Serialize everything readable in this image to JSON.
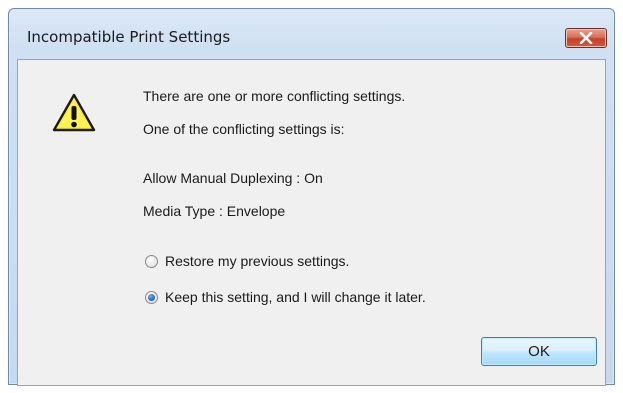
{
  "window": {
    "title": "Incompatible Print Settings"
  },
  "icons": {
    "warning": "warning-icon",
    "close": "close-icon"
  },
  "message": {
    "line1": "There are one or more conflicting settings.",
    "line2": "One of the conflicting settings is:",
    "setting1": "Allow Manual Duplexing : On",
    "setting2": "Media Type : Envelope"
  },
  "options": {
    "restore": {
      "label": "Restore my previous settings.",
      "checked": false
    },
    "keep": {
      "label": "Keep this setting, and I will change it later.",
      "checked": true
    }
  },
  "buttons": {
    "ok": "OK"
  },
  "colors": {
    "close_button": "#c4422a",
    "warning_fill": "#ffef3a",
    "ok_border": "#3c7fb1"
  }
}
